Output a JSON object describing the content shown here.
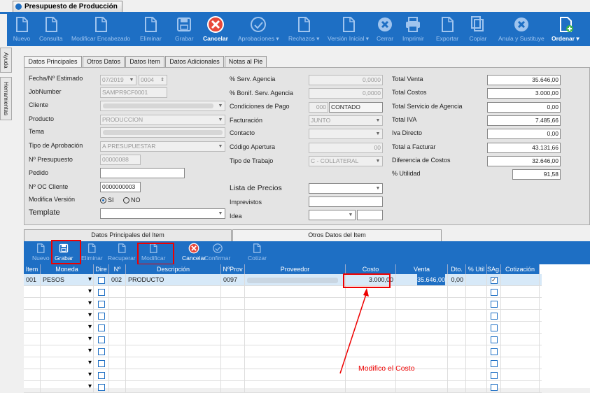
{
  "window": {
    "title": "Presupuesto de Producción"
  },
  "toolbar": [
    {
      "label": "Nuevo",
      "icon": "new-doc-icon",
      "state": "dim"
    },
    {
      "label": "Consulta",
      "icon": "query-doc-icon",
      "state": "dim"
    },
    {
      "label": "Modificar Encabezado",
      "icon": "edit-doc-icon",
      "state": "dim"
    },
    {
      "label": "Eliminar",
      "icon": "delete-doc-icon",
      "state": "dim"
    },
    {
      "label": "Grabar",
      "icon": "save-icon",
      "state": "dim"
    },
    {
      "label": "Cancelar",
      "icon": "cancel-icon",
      "state": "on"
    },
    {
      "label": "Aprobaciones ▾",
      "icon": "approve-icon",
      "state": "dim"
    },
    {
      "label": "Rechazos ▾",
      "icon": "reject-icon",
      "state": "dim"
    },
    {
      "label": "Versión Inicial ▾",
      "icon": "version-icon",
      "state": "dim"
    },
    {
      "label": "Cerrar",
      "icon": "close-icon",
      "state": "dim"
    },
    {
      "label": "Imprimir",
      "icon": "print-icon",
      "state": "dim"
    },
    {
      "label": "Exportar",
      "icon": "export-icon",
      "state": "dim"
    },
    {
      "label": "Copiar",
      "icon": "copy-icon",
      "state": "dim"
    },
    {
      "label": "Anula y Sustituye",
      "icon": "void-icon",
      "state": "dim"
    },
    {
      "label": "Ordenar ▾",
      "icon": "order-icon",
      "state": "on"
    }
  ],
  "side_tabs": [
    "Ayuda",
    "Herramientas"
  ],
  "tabs": [
    "Datos Principales",
    "Otros Datos",
    "Datos Item",
    "Datos Adicionales",
    "Notas al Pie"
  ],
  "form": {
    "fecha_label": "Fecha/Nº Estimado",
    "fecha": "07/2019",
    "estimado": "0004",
    "jobnumber_label": "JobNumber",
    "jobnumber": "SAMPR9CF0001",
    "cliente_label": "Cliente",
    "producto_label": "Producto",
    "producto": "PRODUCCION",
    "tema_label": "Tema",
    "aprob_label": "Tipo de Aprobación",
    "aprob": "A PRESUPUESTAR",
    "npres_label": "Nº Presupuesto",
    "npres": "00000088",
    "pedido_label": "Pedido",
    "oc_label": "Nº OC Cliente",
    "oc": "0000000003",
    "modver_label": "Modifica Versión",
    "si": "SI",
    "no": "NO",
    "template_label": "Template"
  },
  "mid": {
    "serv_label": "% Serv. Agencia",
    "serv": "0,0000",
    "bonif_label": "% Bonif. Serv. Agencia",
    "bonif": "0,0000",
    "cond_label": "Condiciones de Pago",
    "cond_code": "000",
    "cond": "CONTADO",
    "fact_label": "Facturación",
    "fact": "JUNTO",
    "contacto_label": "Contacto",
    "cod_label": "Código Apertura",
    "cod": "00",
    "trab_label": "Tipo de Trabajo",
    "trab": "C - COLLATERAL",
    "lista_label": "Lista de Precios",
    "impr_label": "Imprevistos",
    "idea_label": "Idea"
  },
  "totals": [
    {
      "label": "Total Venta",
      "value": "35.646,00"
    },
    {
      "label": "Total Costos",
      "value": "3.000,00"
    },
    {
      "label": "Total Servicio de Agencia",
      "value": "0,00"
    },
    {
      "label": "Total IVA",
      "value": "7.485,66"
    },
    {
      "label": "Iva Directo",
      "value": "0,00"
    },
    {
      "label": "Total a Facturar",
      "value": "43.131,66"
    },
    {
      "label": "Diferencia de Costos",
      "value": "32.646,00"
    },
    {
      "label": "% Utilidad",
      "value": "91,58"
    }
  ],
  "item_tabs": [
    "Datos Principales del Item",
    "Otros Datos del Item"
  ],
  "item_toolbar": [
    {
      "label": "Nuevo",
      "icon": "new-item-icon",
      "state": "dim"
    },
    {
      "label": "Grabar",
      "icon": "save-icon",
      "state": "on"
    },
    {
      "label": "Eliminar",
      "icon": "delete-item-icon",
      "state": "dim"
    },
    {
      "label": "Recuperar",
      "icon": "recover-icon",
      "state": "dim"
    },
    {
      "label": "Modificar",
      "icon": "edit-item-icon",
      "state": "dim"
    },
    {
      "label": "Cancelar",
      "icon": "cancel-icon",
      "state": "on"
    },
    {
      "label": "Confirmar",
      "icon": "confirm-icon",
      "state": "dim"
    },
    {
      "label": "Cotizar",
      "icon": "quote-icon",
      "state": "dim"
    }
  ],
  "grid": {
    "headers": [
      "Item",
      "Moneda",
      "Dire",
      "Nº",
      "Descripción",
      "NºProv",
      "Proveedor",
      "Costo",
      "Venta",
      "Dto.",
      "% Util",
      "SAg.",
      "Cotización"
    ],
    "row": {
      "item": "001",
      "moneda": "PESOS",
      "n": "002",
      "desc": "PRODUCTO",
      "prov": "0097",
      "costo": "3.000,00",
      "venta": "35.646,00",
      "dto": "0,00"
    }
  },
  "annotation": "Modifico el Costo",
  "colors": {
    "accent": "#1e6fc4",
    "highlight": "#e00000"
  }
}
